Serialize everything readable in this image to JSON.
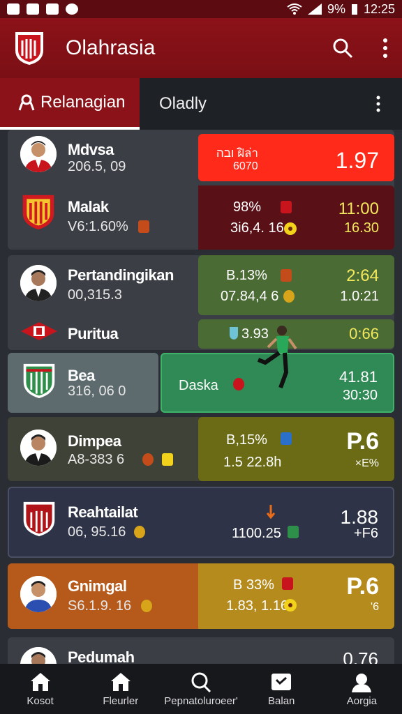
{
  "status": {
    "battery": "9%",
    "time": "12:25"
  },
  "app": {
    "title": "Olahrasia"
  },
  "tabs": {
    "active": "Relanagian",
    "inactive": "Oladly"
  },
  "rows": [
    {
      "name": "Mdvsa",
      "sub": "206.5, 09",
      "p1": "ובה ฝิล่า",
      "p2": "6070",
      "v1": "1.97",
      "v2": ""
    },
    {
      "name": "Malak",
      "sub": "V6:1.60%",
      "p1": "98%",
      "p2": "3i6,4. 16",
      "v1": "11:00",
      "v2": "16.30"
    },
    {
      "name": "Pertandingikan",
      "sub": "00,315.3",
      "p1": "B.13%",
      "p2": "07.84,4 6",
      "v1": "2:64",
      "v2": "1.0:21"
    },
    {
      "name": "Puritua",
      "sub": "",
      "p1": "3.93",
      "p2": "",
      "v1": "0:66",
      "v2": ""
    },
    {
      "name": "Bea",
      "sub": "316, 06 0",
      "p1": "Daska",
      "p2": "",
      "v1": "41.81",
      "v2": "30:30"
    },
    {
      "name": "Dimpea",
      "sub": "A8-383 6",
      "p1": "B,15%",
      "p2": "1.5 22.8h",
      "v1": "P.6",
      "v2": "×E%"
    },
    {
      "name": "Reahtailat",
      "sub": "06, 95.16",
      "p1": "",
      "p2": "1100.25",
      "v1": "1.88",
      "v2": "+F6"
    },
    {
      "name": "Gnimgal",
      "sub": "S6.1.9. 16",
      "p1": "B 33%",
      "p2": "1.83, 1.16",
      "v1": "P.6",
      "v2": "'6"
    },
    {
      "name": "Pedumah",
      "sub": "",
      "p1": "",
      "p2": "",
      "v1": "0.76",
      "v2": ""
    }
  ],
  "nav": [
    {
      "label": "Kosot",
      "icon": "home-icon"
    },
    {
      "label": "Fleurler",
      "icon": "home-icon"
    },
    {
      "label": "Pepnatoluroeer'",
      "icon": "search-icon"
    },
    {
      "label": "Balan",
      "icon": "ticket-icon"
    },
    {
      "label": "Aorgia",
      "icon": "user-icon"
    }
  ],
  "colors": {
    "brand": "#8b1218",
    "red": "#ff2a1a",
    "maroon": "#5a1017",
    "green": "#4b6b34",
    "olive": "#6a6b14",
    "orange": "#b55a1b",
    "gold": "#b58b1e",
    "yellow": "#f2e85c"
  }
}
